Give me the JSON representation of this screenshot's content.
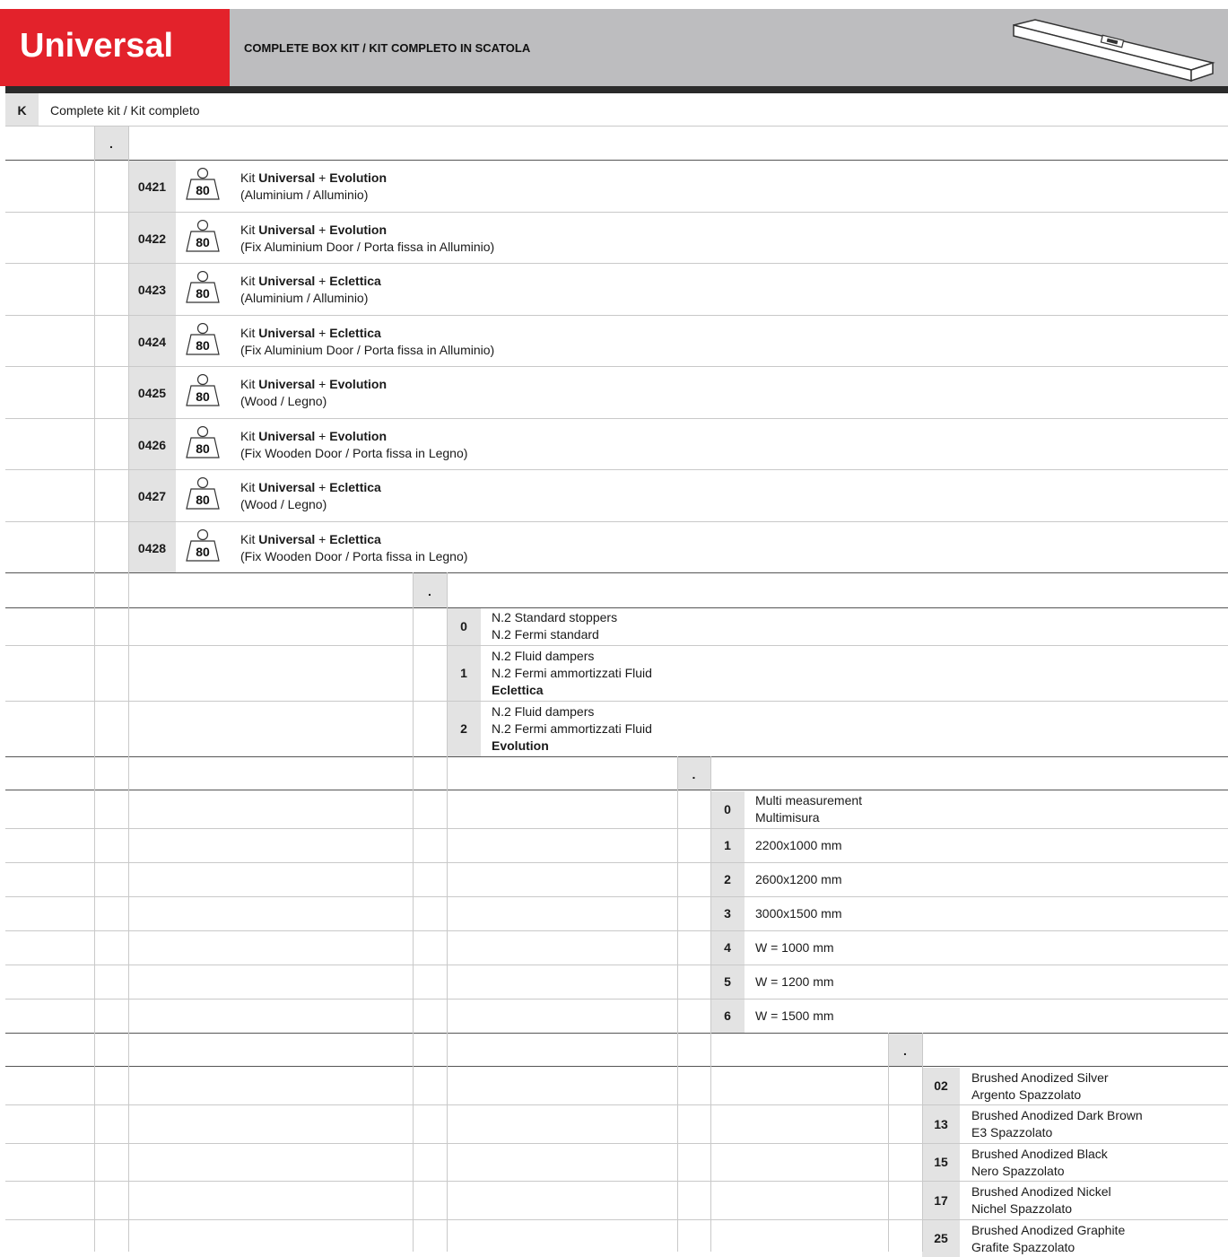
{
  "header": {
    "title": "Universal",
    "subtitle": "COMPLETE BOX KIT / KIT COMPLETO IN SCATOLA",
    "brand_color": "#e3222b",
    "header_bg": "#bdbdbf",
    "icon": "box-profile-icon"
  },
  "section_k": {
    "code": "K",
    "label": "Complete kit / Kit completo"
  },
  "separator": ".",
  "kits": {
    "weight_value": "80",
    "weight_icon": "weight-80kg-icon",
    "items": [
      {
        "code": "0421",
        "prefix": "Kit",
        "name": "Universal",
        "plus": "+",
        "model": "Evolution",
        "note": "(Aluminium / Alluminio)"
      },
      {
        "code": "0422",
        "prefix": "Kit",
        "name": "Universal",
        "plus": "+",
        "model": "Evolution",
        "note": "(Fix Aluminium Door / Porta fissa in Alluminio)"
      },
      {
        "code": "0423",
        "prefix": "Kit",
        "name": "Universal",
        "plus": "+",
        "model": "Eclettica",
        "note": "(Aluminium / Alluminio)"
      },
      {
        "code": "0424",
        "prefix": "Kit",
        "name": "Universal",
        "plus": "+",
        "model": "Eclettica",
        "note": "(Fix Aluminium Door / Porta fissa in Alluminio)"
      },
      {
        "code": "0425",
        "prefix": "Kit",
        "name": "Universal",
        "plus": "+",
        "model": "Evolution",
        "note": "(Wood / Legno)"
      },
      {
        "code": "0426",
        "prefix": "Kit",
        "name": "Universal",
        "plus": "+",
        "model": "Evolution",
        "note": "(Fix Wooden Door / Porta fissa in Legno)"
      },
      {
        "code": "0427",
        "prefix": "Kit",
        "name": "Universal",
        "plus": "+",
        "model": "Eclettica",
        "note": "(Wood / Legno)"
      },
      {
        "code": "0428",
        "prefix": "Kit",
        "name": "Universal",
        "plus": "+",
        "model": "Eclettica",
        "note": "(Fix Wooden Door / Porta fissa in Legno)"
      }
    ]
  },
  "stoppers": [
    {
      "code": "0",
      "line1": "N.2 Standard stoppers",
      "line2": "N.2 Fermi standard",
      "line3": ""
    },
    {
      "code": "1",
      "line1": "N.2 Fluid dampers",
      "line2": "N.2 Fermi ammortizzati Fluid",
      "line3": "Eclettica"
    },
    {
      "code": "2",
      "line1": "N.2 Fluid dampers",
      "line2": "N.2 Fermi ammortizzati Fluid",
      "line3": "Evolution"
    }
  ],
  "sizes": [
    {
      "code": "0",
      "line1": "Multi measurement",
      "line2": "Multimisura"
    },
    {
      "code": "1",
      "line1": "2200x1000 mm",
      "line2": ""
    },
    {
      "code": "2",
      "line1": "2600x1200 mm",
      "line2": ""
    },
    {
      "code": "3",
      "line1": "3000x1500 mm",
      "line2": ""
    },
    {
      "code": "4",
      "line1": "W = 1000 mm",
      "line2": ""
    },
    {
      "code": "5",
      "line1": "W = 1200 mm",
      "line2": ""
    },
    {
      "code": "6",
      "line1": "W = 1500 mm",
      "line2": ""
    }
  ],
  "finishes": [
    {
      "code": "02",
      "line1": "Brushed Anodized Silver",
      "line2": "Argento Spazzolato"
    },
    {
      "code": "13",
      "line1": "Brushed Anodized Dark Brown",
      "line2": "E3 Spazzolato"
    },
    {
      "code": "15",
      "line1": "Brushed Anodized Black",
      "line2": "Nero Spazzolato"
    },
    {
      "code": "17",
      "line1": "Brushed Anodized Nickel",
      "line2": "Nichel Spazzolato"
    },
    {
      "code": "25",
      "line1": "Brushed Anodized Graphite",
      "line2": "Grafite Spazzolato"
    }
  ]
}
